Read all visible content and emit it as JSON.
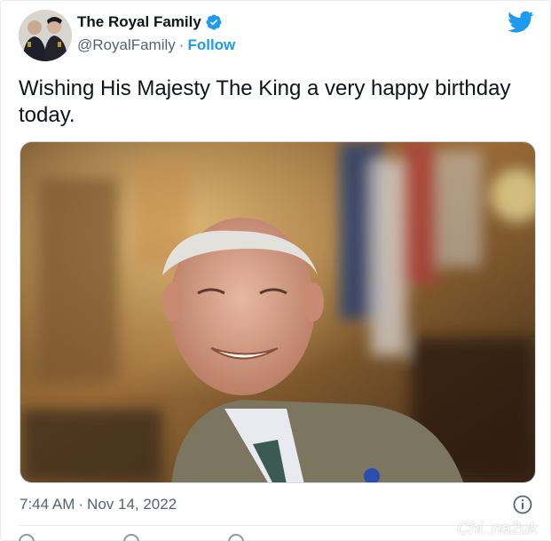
{
  "account": {
    "display_name": "The Royal Family",
    "handle": "@RoyalFamily",
    "separator": "·",
    "follow_label": "Follow"
  },
  "tweet": {
    "text": "Wishing His Majesty The King a very happy birthday today.",
    "time": "7:44 AM",
    "date": "Nov 14, 2022",
    "separator": "·"
  },
  "icons": {
    "brand": "twitter-bird-icon",
    "verified": "verified-badge-icon",
    "info": "info-icon"
  },
  "colors": {
    "accent": "#1d9bf0",
    "text": "#0f1419",
    "muted": "#536471"
  },
  "watermark": "Chi..na2uk"
}
